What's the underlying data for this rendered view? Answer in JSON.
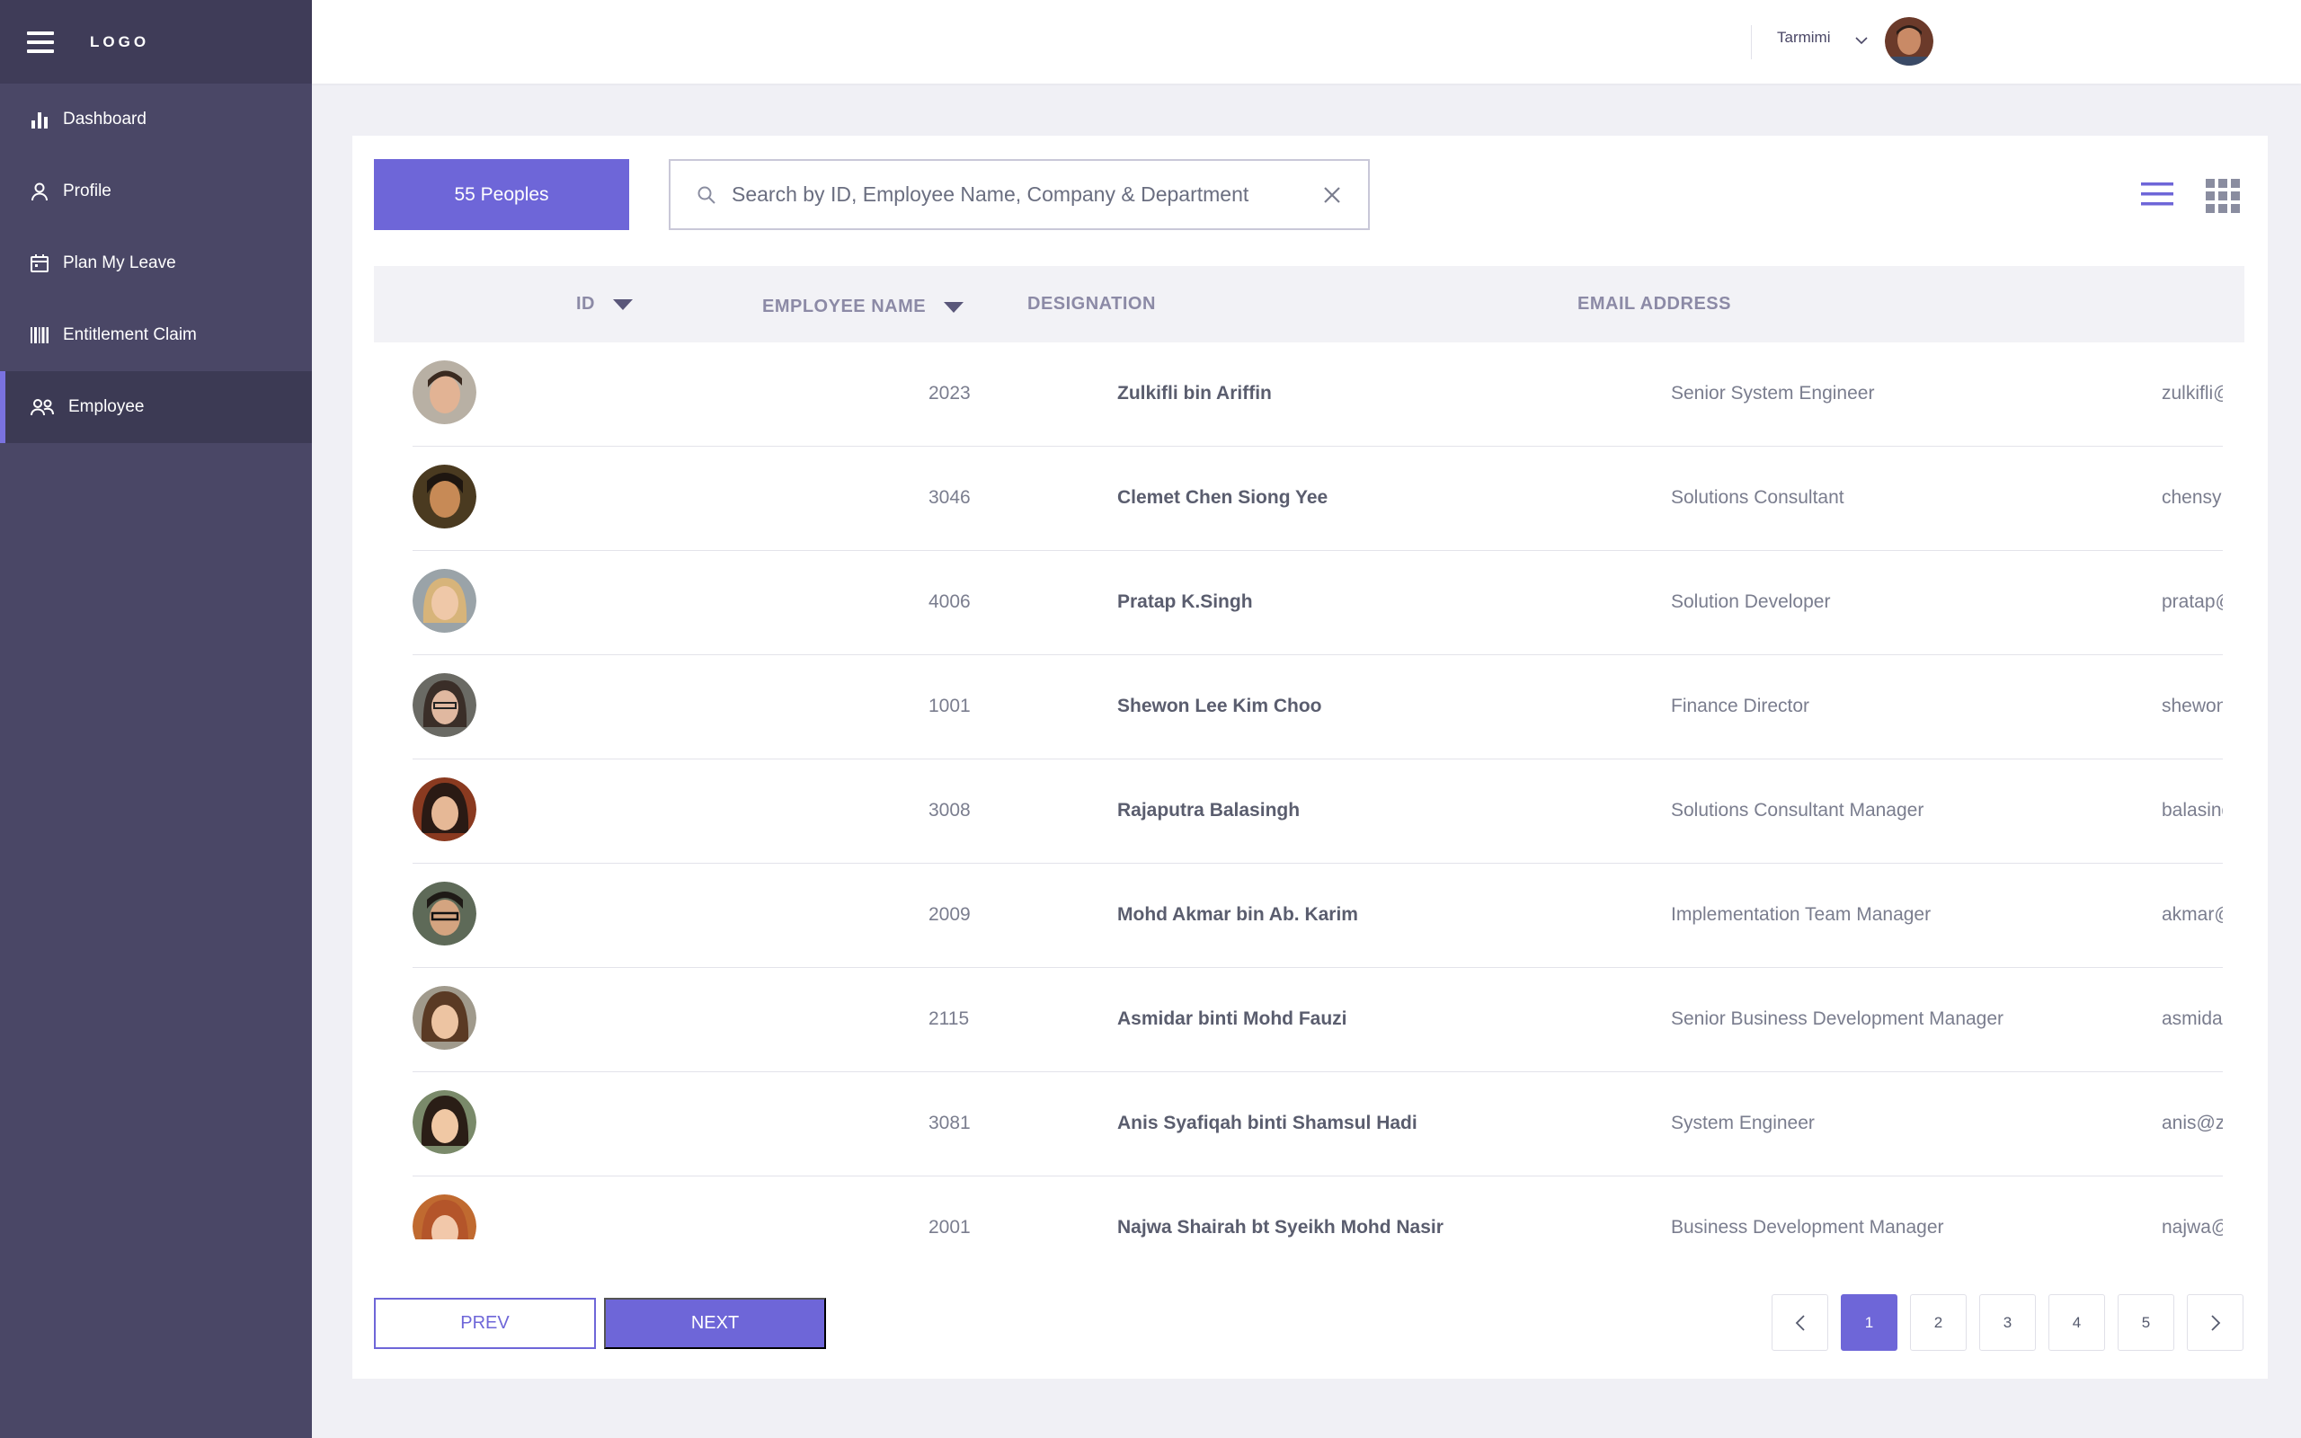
{
  "sidebar": {
    "logo": "LOGO",
    "items": [
      {
        "label": "Dashboard",
        "icon": "bar-chart-icon"
      },
      {
        "label": "Profile",
        "icon": "person-icon"
      },
      {
        "label": "Plan My Leave",
        "icon": "calendar-icon"
      },
      {
        "label": "Entitlement Claim",
        "icon": "barcode-icon"
      },
      {
        "label": "Employee",
        "icon": "people-icon",
        "active": true
      }
    ]
  },
  "header": {
    "user_name": "Tarmimi"
  },
  "toolbar": {
    "count_label": "55 Peoples",
    "search_placeholder": "Search by ID, Employee Name, Company & Department"
  },
  "table": {
    "columns": {
      "id": "ID",
      "name": "EMPLOYEE NAME",
      "designation": "DESIGNATION",
      "email": "EMAIL ADDRESS"
    },
    "rows": [
      {
        "id": "2023",
        "name": "Zulkifli bin Ariffin",
        "designation": "Senior System Engineer",
        "email": "zulkifli@zen.com.my"
      },
      {
        "id": "3046",
        "name": "Clemet Chen Siong Yee",
        "designation": "Solutions Consultant",
        "email": "chensy@zen.com.my"
      },
      {
        "id": "4006",
        "name": "Pratap K.Singh",
        "designation": "Solution Developer",
        "email": "pratap@zen.com.my"
      },
      {
        "id": "1001",
        "name": "Shewon Lee Kim Choo",
        "designation": "Finance Director",
        "email": "shewonlee@zen.com.my"
      },
      {
        "id": "3008",
        "name": "Rajaputra Balasingh",
        "designation": "Solutions Consultant Manager",
        "email": "balasingh@zen.com.my"
      },
      {
        "id": "2009",
        "name": "Mohd Akmar bin Ab. Karim",
        "designation": "Implementation Team Manager",
        "email": "akmar@zen.com.my"
      },
      {
        "id": "2115",
        "name": "Asmidar binti Mohd Fauzi",
        "designation": "Senior Business Development Manager",
        "email": "asmidar@zen.com.my"
      },
      {
        "id": "3081",
        "name": "Anis Syafiqah binti Shamsul Hadi",
        "designation": "System Engineer",
        "email": "anis@zen.com.my"
      },
      {
        "id": "2001",
        "name": "Najwa Shairah bt Syeikh Mohd Nasir",
        "designation": "Business Development Manager",
        "email": "najwa@zen.com.my"
      }
    ]
  },
  "footer": {
    "prev_label": "PREV",
    "next_label": "NEXT",
    "pages": [
      "1",
      "2",
      "3",
      "4",
      "5"
    ],
    "current_page": "1"
  },
  "colors": {
    "accent": "#6e66d8",
    "sidebar": "#4a4766",
    "sidebar_header": "#3f3c58"
  }
}
